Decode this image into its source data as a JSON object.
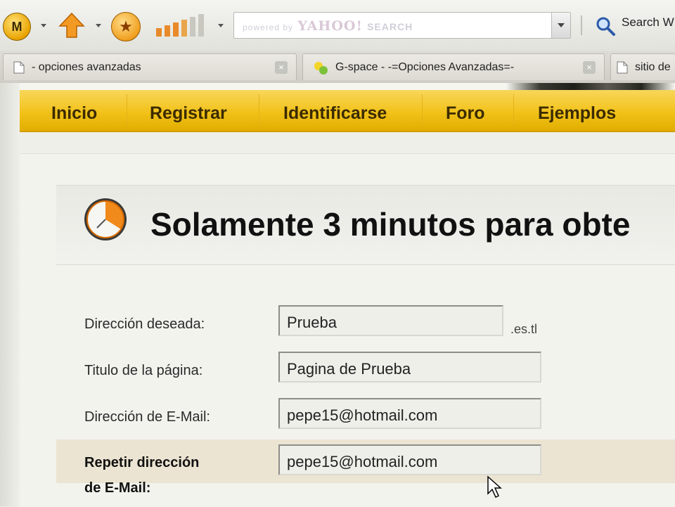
{
  "toolbar": {
    "mlogo_glyph": "M",
    "search_brand_prefix": "powered by",
    "search_brand_name": "YAHOO!",
    "search_brand_suffix": "SEARCH",
    "search_label": "Search W"
  },
  "tabs": [
    {
      "label": "- opciones avanzadas"
    },
    {
      "label": "G-space - -=Opciones Avanzadas=-"
    },
    {
      "label": "sitio de"
    }
  ],
  "nav": [
    "Inicio",
    "Registrar",
    "Identificarse",
    "Foro",
    "Ejemplos"
  ],
  "banner": {
    "title": "Solamente 3 minutos para obte"
  },
  "form": {
    "field1_label": "Dirección deseada:",
    "field1_value": "Prueba",
    "field1_suffix": ".es.tl",
    "field2_label": "Titulo de la página:",
    "field2_value": "Pagina de Prueba",
    "field3_label": "Dirección de E-Mail:",
    "field3_value": "pepe15@hotmail.com",
    "field4_label_line1": "Repetir dirección",
    "field4_label_line2": "de E-Mail:",
    "field4_value": "pepe15@hotmail.com"
  }
}
